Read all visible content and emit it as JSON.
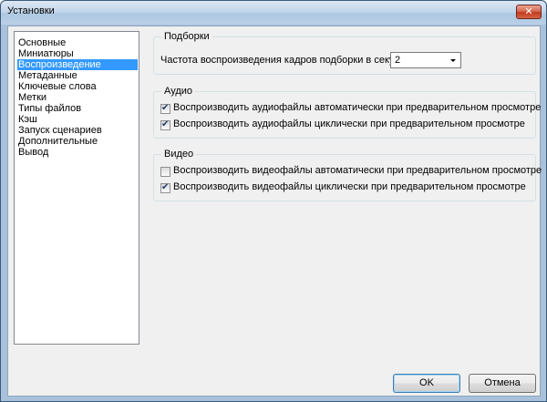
{
  "window": {
    "title": "Установки",
    "close_label": "✕"
  },
  "categories": {
    "items": [
      {
        "label": "Основные"
      },
      {
        "label": "Миниатюры"
      },
      {
        "label": "Воспроизведение"
      },
      {
        "label": "Метаданные"
      },
      {
        "label": "Ключевые слова"
      },
      {
        "label": "Метки"
      },
      {
        "label": "Типы файлов"
      },
      {
        "label": "Кэш"
      },
      {
        "label": "Запуск сценариев"
      },
      {
        "label": "Дополнительные"
      },
      {
        "label": "Вывод"
      }
    ],
    "selected": "Воспроизведение"
  },
  "stacks": {
    "title": "Подборки",
    "fps_label": "Частота воспроизведения кадров подборки в секунду:",
    "fps_value": "2"
  },
  "audio": {
    "title": "Аудио",
    "autoplay_label": "Воспроизводить аудиофайлы автоматически при предварительном просмотре",
    "autoplay_checked": true,
    "loop_label": "Воспроизводить аудиофайлы циклически при предварительном просмотре",
    "loop_checked": true
  },
  "video": {
    "title": "Видео",
    "autoplay_label": "Воспроизводить видеофайлы автоматически при предварительном просмотре",
    "autoplay_checked": false,
    "loop_label": "Воспроизводить видеофайлы циклически при предварительном просмотре",
    "loop_checked": true
  },
  "buttons": {
    "ok": "OK",
    "cancel": "Отмена"
  }
}
